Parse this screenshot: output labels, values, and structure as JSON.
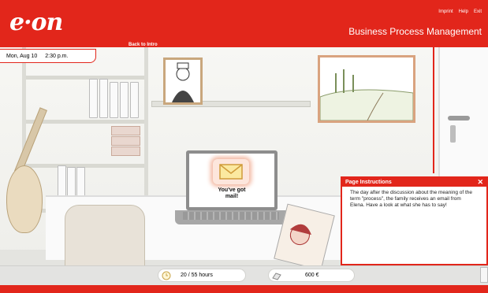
{
  "header": {
    "logo": "e·on",
    "links": [
      "Imprint",
      "Help",
      "Exit"
    ],
    "title": "Business Process Management",
    "back_link": "Back to Intro"
  },
  "status": {
    "date": "Mon, Aug 10",
    "time": "2:30 p.m."
  },
  "laptop": {
    "mail_line1": "You've got",
    "mail_line2": "mail!"
  },
  "instructions": {
    "title": "Page Instructions",
    "close": "✕",
    "body": "The day after the discussion about the meaning of the term \"process\", the family receives an email from Elena. Have a look at what she has to say!"
  },
  "bottom": {
    "hours": "20 / 55 hours",
    "money": "600 €"
  },
  "colors": {
    "brand_red": "#e2261b"
  }
}
